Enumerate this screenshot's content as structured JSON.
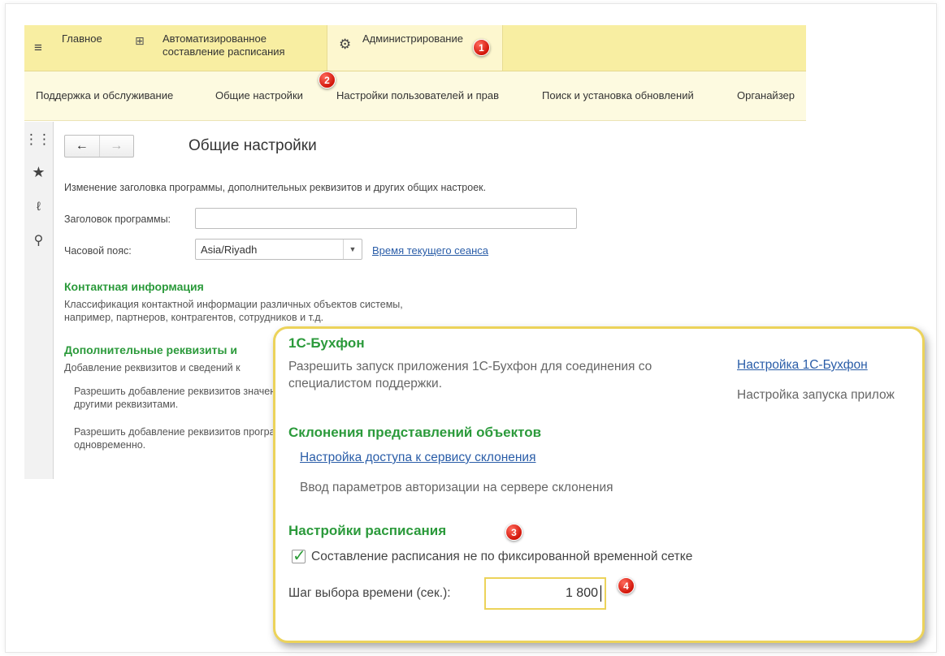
{
  "sections": {
    "main": "Главное",
    "auto_schedule": "Автоматизированное составление расписания",
    "admin": "Администрирование"
  },
  "functions_bar": {
    "items": [
      "Поддержка и обслуживание",
      "Общие настройки",
      "Настройки пользователей и прав",
      "Поиск и установка обновлений",
      "Органайзер"
    ]
  },
  "badges": [
    "1",
    "2",
    "3",
    "4"
  ],
  "toolbar": {
    "icons": [
      "apps-grid-icon",
      "star-icon",
      "history-icon",
      "search-icon"
    ]
  },
  "form": {
    "title": "Общие настройки",
    "description": "Изменение заголовка программы, дополнительных реквизитов и других общих настроек.",
    "caption_label": "Заголовок программы:",
    "caption_value": "",
    "timezone_label": "Часовой пояс:",
    "timezone_value": "Asia/Riyadh",
    "session_time_link": "Время текущего сеанса",
    "contact": {
      "title": "Контактная информация",
      "description": "Классификация контактной информации различных объектов системы, например, партнеров, контрагентов, сотрудников и т.д."
    },
    "props": {
      "title": "Дополнительные реквизиты и",
      "description": "Добавление реквизитов и сведений к",
      "option1": "Разрешить добавление реквизитов значений с другими реквизитами.",
      "option2": "Разрешить добавление реквизитов программы одновременно."
    }
  },
  "zoom": {
    "buhfon": {
      "title": "1С-Бухфон",
      "description": "Разрешить запуск приложения 1С-Бухфон для соединения со специалистом поддержки.",
      "link": "Настройка 1С-Бухфон",
      "note": "Настройка запуска прилож"
    },
    "declension": {
      "title": "Склонения представлений объектов",
      "link": "Настройка доступа к сервису склонения",
      "note": "Ввод параметров авторизации на сервере склонения"
    },
    "schedule": {
      "title": "Настройки расписания",
      "checkbox_label": "Составление расписания не по фиксированной временной сетке",
      "checkbox_checked": true,
      "step_label": "Шаг выбора времени (сек.):",
      "step_value": "1 800"
    }
  },
  "colors": {
    "section_panel": "#f8eea2",
    "functions_bar": "#fdfae0",
    "group_title_green": "#2b9a3b",
    "link_blue": "#2a5da8",
    "callout_border": "#ecd35a",
    "badge_red": "#d2160a"
  }
}
